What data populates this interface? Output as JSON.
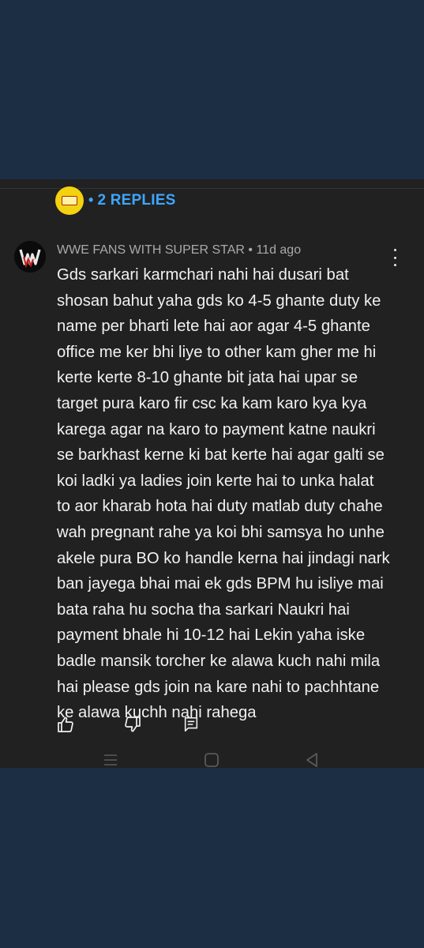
{
  "replies": {
    "dot": "•",
    "label": "2 REPLIES",
    "avatar_icon": "channel-logo-icon"
  },
  "comment": {
    "author": "WWE FANS WITH SUPER STAR",
    "separator": "•",
    "time": "11d ago",
    "avatar_icon": "wwe-logo-icon",
    "text": "Gds sarkari karmchari nahi hai dusari bat\nshosan bahut yaha gds ko 4-5 ghante duty ke\nname per bharti lete hai aor agar 4-5 ghante\noffice me ker bhi liye to other kam gher me hi\nkerte kerte 8-10 ghante bit jata hai upar se\ntarget pura karo fir csc ka kam karo kya kya\nkarega agar na karo to payment katne naukri\nse barkhast kerne ki bat kerte hai agar galti se\nkoi ladki ya ladies join kerte hai to unka halat\nto aor kharab hota hai duty matlab duty chahe\nwah pregnant rahe ya koi bhi samsya ho unhe\nakele pura BO ko handle kerna hai jindagi nark\nban jayega bhai mai ek gds BPM hu isliye mai\nbata raha hu socha tha sarkari Naukri hai\npayment bhale hi 10-12 hai Lekin yaha iske\nbadle mansik torcher ke alawa kuch nahi mila\nhai please gds join na kare nahi to pachhtane\nke alawa kuchh nahi rahega"
  },
  "actions": {
    "like_icon": "thumbs-up-icon",
    "dislike_icon": "thumbs-down-icon",
    "reply_icon": "reply-comment-icon"
  },
  "navbar": {
    "recents_icon": "recent-apps-icon",
    "home_icon": "home-icon",
    "back_icon": "back-icon"
  },
  "colors": {
    "page_background": "#1b2e43",
    "panel_background": "#212121",
    "link": "#3ea6ff",
    "text": "#f1f1f1",
    "meta": "#aaaaaa"
  }
}
